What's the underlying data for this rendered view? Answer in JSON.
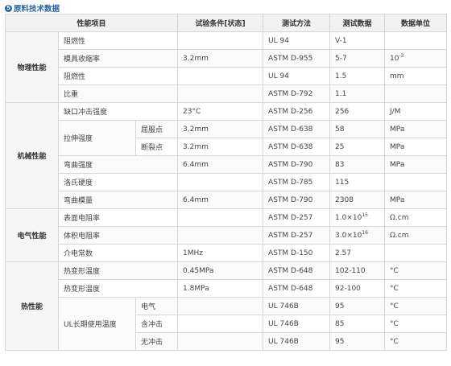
{
  "section": {
    "number": "5",
    "title": "原料技术数据"
  },
  "columns": [
    "性能项目",
    "试验条件[状态]",
    "测试方法",
    "测试数据",
    "数据单位"
  ],
  "rows": {
    "r1": {
      "category": "物理性能",
      "item": "阻燃性",
      "cond": "",
      "method": "UL 94",
      "data": "V-1",
      "unit": ""
    },
    "r2": {
      "item": "模具收缩率",
      "cond": "3.2mm",
      "method": "ASTM D-955",
      "data": "5-7",
      "unit": "10",
      "unit_sup": "-3"
    },
    "r3": {
      "item": "阻燃性",
      "cond": "",
      "method": "UL 94",
      "data": "1.5",
      "unit": "mm"
    },
    "r4": {
      "item": "比重",
      "cond": "",
      "method": "ASTM D-792",
      "data": "1.1",
      "unit": ""
    },
    "r5": {
      "category": "机械性能",
      "item": "缺口冲击强度",
      "cond": "23°C",
      "method": "ASTM D-256",
      "data": "256",
      "unit": "J/M"
    },
    "r6": {
      "item": "拉伸强度",
      "sub": "屈服点",
      "cond": "3.2mm",
      "method": "ASTM D-638",
      "data": "58",
      "unit": "MPa"
    },
    "r7": {
      "sub": "断裂点",
      "cond": "3.2mm",
      "method": "ASTM D-638",
      "data": "25",
      "unit": "MPa"
    },
    "r8": {
      "item": "弯曲强度",
      "cond": "6.4mm",
      "method": "ASTM D-790",
      "data": "83",
      "unit": "MPa"
    },
    "r9": {
      "item": "洛氏硬度",
      "cond": "",
      "method": "ASTM D-785",
      "data": "115",
      "unit": ""
    },
    "r10": {
      "item": "弯曲模量",
      "cond": "6.4mm",
      "method": "ASTM D-790",
      "data": "2308",
      "unit": "MPa"
    },
    "r11": {
      "category": "电气性能",
      "item": "表面电阻率",
      "cond": "",
      "method": "ASTM D-257",
      "data": "1.0×10",
      "data_sup": "15",
      "unit": "Ω.cm"
    },
    "r12": {
      "item": "体积电阻率",
      "cond": "",
      "method": "ASTM D-257",
      "data": "3.0×10",
      "data_sup": "16",
      "unit": "Ω.cm"
    },
    "r13": {
      "item": "介电常数",
      "cond": "1MHz",
      "method": "ASTM D-150",
      "data": "2.57",
      "unit": ""
    },
    "r14": {
      "category": "热性能",
      "item": "热变形温度",
      "cond": "0.45MPa",
      "method": "ASTM D-648",
      "data": "102-110",
      "unit": "°C"
    },
    "r15": {
      "item": "热变形温度",
      "cond": "1.8MPa",
      "method": "ASTM D-648",
      "data": "92-100",
      "unit": "°C"
    },
    "r16": {
      "item": "UL长期使用温度",
      "sub": "电气",
      "cond": "",
      "method": "UL 746B",
      "data": "95",
      "unit": "°C"
    },
    "r17": {
      "sub": "含冲击",
      "cond": "",
      "method": "UL 746B",
      "data": "85",
      "unit": "°C"
    },
    "r18": {
      "sub": "无冲击",
      "cond": "",
      "method": "UL 746B",
      "data": "95",
      "unit": "°C"
    }
  }
}
